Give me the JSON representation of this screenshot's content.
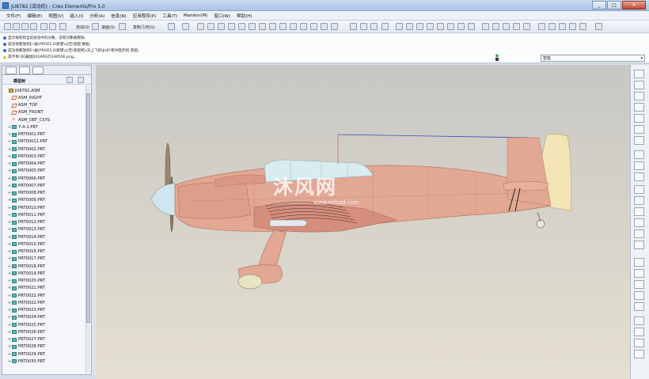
{
  "window": {
    "title": "JU8782 (活动的) - Creo Elements/Pro 5.0",
    "min_glyph": "_",
    "max_glyph": "□",
    "close_glyph": "✕"
  },
  "menus": [
    "文件(F)",
    "编辑(E)",
    "视图(V)",
    "插入(I)",
    "分析(A)",
    "信息(N)",
    "应用程序(P)",
    "工具(T)",
    "Manikin(M)",
    "窗口(W)",
    "帮助(H)"
  ],
  "toolbar": {
    "redraw_label": "自动(S)",
    "surface_label": "速画(S)",
    "copy_label": "复制几何(G)"
  },
  "messages": [
    {
      "type": "info",
      "text": "显示样有到当前会话中的对象。没有对象被擦除。"
    },
    {
      "type": "info",
      "text": "成功地重放到E:\\桌(PROE5.0\\新建\\公告\\装配 数据。"
    },
    {
      "type": "info",
      "text": "成功地重放到E:\\桌(PROE5.0\\新建\\公告\\装配机\\(天上飞的\\JU87俯冲轰炸机 装配。"
    },
    {
      "type": "warn",
      "text": "其不保 QQ截图20190925190506.png。"
    }
  ],
  "filter": {
    "value": "智能"
  },
  "model_tree": {
    "header": "模型树",
    "items": [
      {
        "label": "JU8782.ASM",
        "kind": "asm",
        "expand": ""
      },
      {
        "label": "ASM_RIGHT",
        "kind": "plane",
        "expand": ""
      },
      {
        "label": "ASM_TOP",
        "kind": "plane",
        "expand": ""
      },
      {
        "label": "ASM_FRONT",
        "kind": "plane",
        "expand": ""
      },
      {
        "label": "ASM_DEF_CSYS",
        "kind": "csys",
        "expand": ""
      },
      {
        "label": "7-4-1.PRT",
        "kind": "prt",
        "expand": "+"
      },
      {
        "label": "PRT0001.PRT",
        "kind": "prt",
        "expand": "+"
      },
      {
        "label": "PRT00011.PRT",
        "kind": "prt",
        "expand": "+"
      },
      {
        "label": "PRT0002.PRT",
        "kind": "prt",
        "expand": "+"
      },
      {
        "label": "PRT0003.PRT",
        "kind": "prt",
        "expand": "+"
      },
      {
        "label": "PRT0004.PRT",
        "kind": "prt",
        "expand": "+"
      },
      {
        "label": "PRT0005.PRT",
        "kind": "prt",
        "expand": "+"
      },
      {
        "label": "PRT0006.PRT",
        "kind": "prt",
        "expand": "+"
      },
      {
        "label": "PRT0007.PRT",
        "kind": "prt",
        "expand": "+"
      },
      {
        "label": "PRT0008.PRT",
        "kind": "prt",
        "expand": "+"
      },
      {
        "label": "PRT0009.PRT",
        "kind": "prt",
        "expand": "+"
      },
      {
        "label": "PRT0010.PRT",
        "kind": "prt",
        "expand": "+"
      },
      {
        "label": "PRT0011.PRT",
        "kind": "prt",
        "expand": "+"
      },
      {
        "label": "PRT0012.PRT",
        "kind": "prt",
        "expand": "+"
      },
      {
        "label": "PRT0013.PRT",
        "kind": "prt",
        "expand": "+"
      },
      {
        "label": "PRT0014.PRT",
        "kind": "prt",
        "expand": "+"
      },
      {
        "label": "PRT0015.PRT",
        "kind": "prt",
        "expand": "+"
      },
      {
        "label": "PRT0016.PRT",
        "kind": "prt",
        "expand": "+"
      },
      {
        "label": "PRT0017.PRT",
        "kind": "prt",
        "expand": "+"
      },
      {
        "label": "PRT0018.PRT",
        "kind": "prt",
        "expand": "+"
      },
      {
        "label": "PRT0019.PRT",
        "kind": "prt",
        "expand": "+"
      },
      {
        "label": "PRT0020.PRT",
        "kind": "prt",
        "expand": "+"
      },
      {
        "label": "PRT0021.PRT",
        "kind": "prt",
        "expand": "+"
      },
      {
        "label": "PRT0022.PRT",
        "kind": "prt",
        "expand": "+"
      },
      {
        "label": "PRT0022.PRT",
        "kind": "prt",
        "expand": "+"
      },
      {
        "label": "PRT0023.PRT",
        "kind": "prt",
        "expand": "+"
      },
      {
        "label": "PRT0024.PRT",
        "kind": "prt",
        "expand": "+"
      },
      {
        "label": "PRT0025.PRT",
        "kind": "prt",
        "expand": "+"
      },
      {
        "label": "PRT0026.PRT",
        "kind": "prt",
        "expand": "+"
      },
      {
        "label": "PRT0027.PRT",
        "kind": "prt",
        "expand": "+"
      },
      {
        "label": "PRT0028.PRT",
        "kind": "prt",
        "expand": "+"
      },
      {
        "label": "PRT0029.PRT",
        "kind": "prt",
        "expand": "+"
      },
      {
        "label": "PRT0030.PRT",
        "kind": "prt",
        "expand": "+"
      }
    ]
  },
  "viewport": {
    "watermark": "沐风网",
    "watermark_url": "www.mfcad.com"
  },
  "colors": {
    "fuselage": "#e2a894",
    "canopy": "#d9ecef",
    "tail": "#f3e5b5",
    "accent": "#2d6fc4"
  }
}
